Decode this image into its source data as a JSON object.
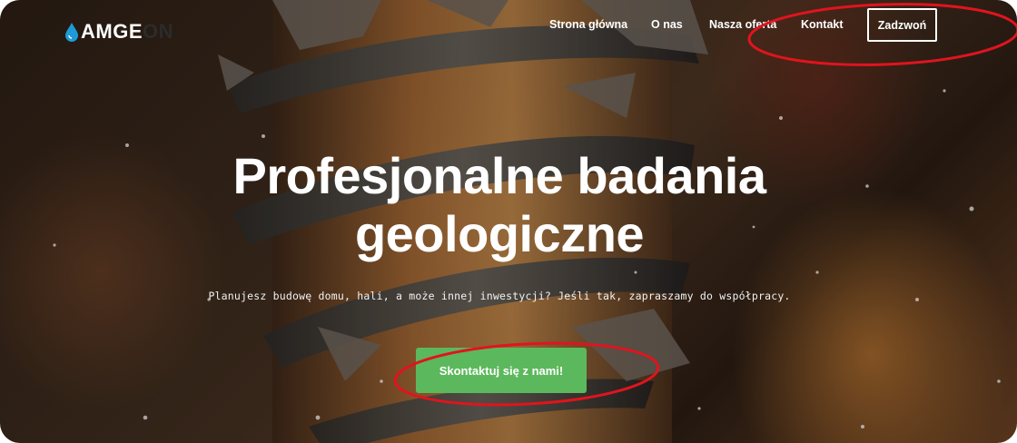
{
  "logo": {
    "text_a": "AMGE",
    "text_b": "GE",
    "text_c": "ON",
    "colors": {
      "white": "#ffffff",
      "green": "#5bc35e",
      "drop": "#1e9bd7"
    }
  },
  "nav": {
    "items": [
      {
        "label": "Strona główna"
      },
      {
        "label": "O nas"
      },
      {
        "label": "Nasza oferta"
      },
      {
        "label": "Kontakt"
      }
    ],
    "call_button": "Zadzwoń"
  },
  "hero": {
    "title_line1": "Profesjonalne badania",
    "title_line2": "geologiczne",
    "subtitle": "Planujesz budowę domu, hali, a może innej inwestycji? Jeśli tak, zapraszamy do współpracy.",
    "cta": "Skontaktuj się z nami!"
  },
  "colors": {
    "cta_green": "#5cb85c",
    "annotation_red": "#e0141e"
  }
}
